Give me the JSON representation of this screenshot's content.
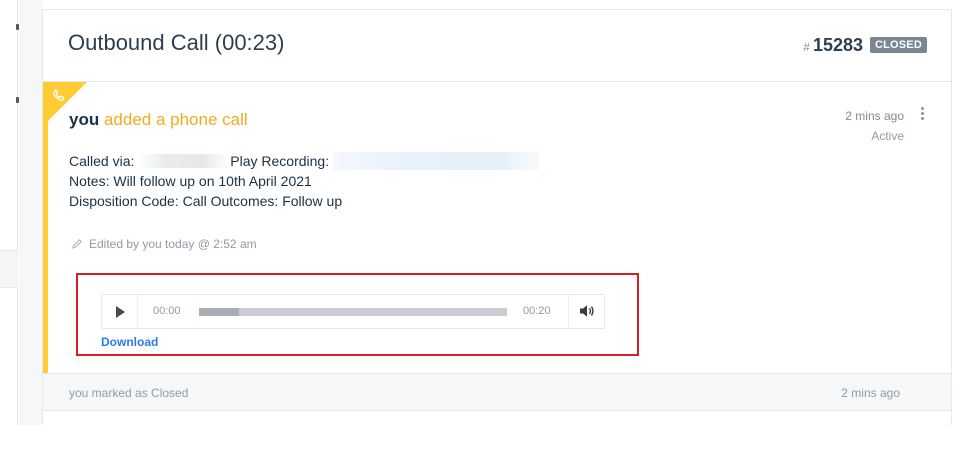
{
  "ticket": {
    "title": "Outbound Call (00:23)",
    "hash": "#",
    "id": "15283",
    "status": "CLOSED"
  },
  "activity": {
    "actor": "you",
    "action": " added a phone call",
    "time": "2 mins ago",
    "state": "Active",
    "called_via_label": "Called via:",
    "play_recording_label": "Play Recording:",
    "notes": "Notes: Will follow up on 10th April 2021",
    "disposition": "Disposition Code: Call Outcomes: Follow up",
    "edited": "Edited by you today @ 2:52 am"
  },
  "player": {
    "current_time": "00:00",
    "total_time": "00:20",
    "buffered_fraction": 0.13,
    "download_label": "Download"
  },
  "footer": {
    "text": "you marked as Closed",
    "time": "2 mins ago"
  },
  "colors": {
    "accent": "#ffcc33",
    "action_text": "#f2ab1e",
    "link": "#2c7be5",
    "badge": "#7b8693",
    "highlight": "#d42027"
  },
  "icons": [
    "phone-icon",
    "kebab-menu-icon",
    "pencil-icon",
    "play-icon",
    "volume-icon"
  ]
}
